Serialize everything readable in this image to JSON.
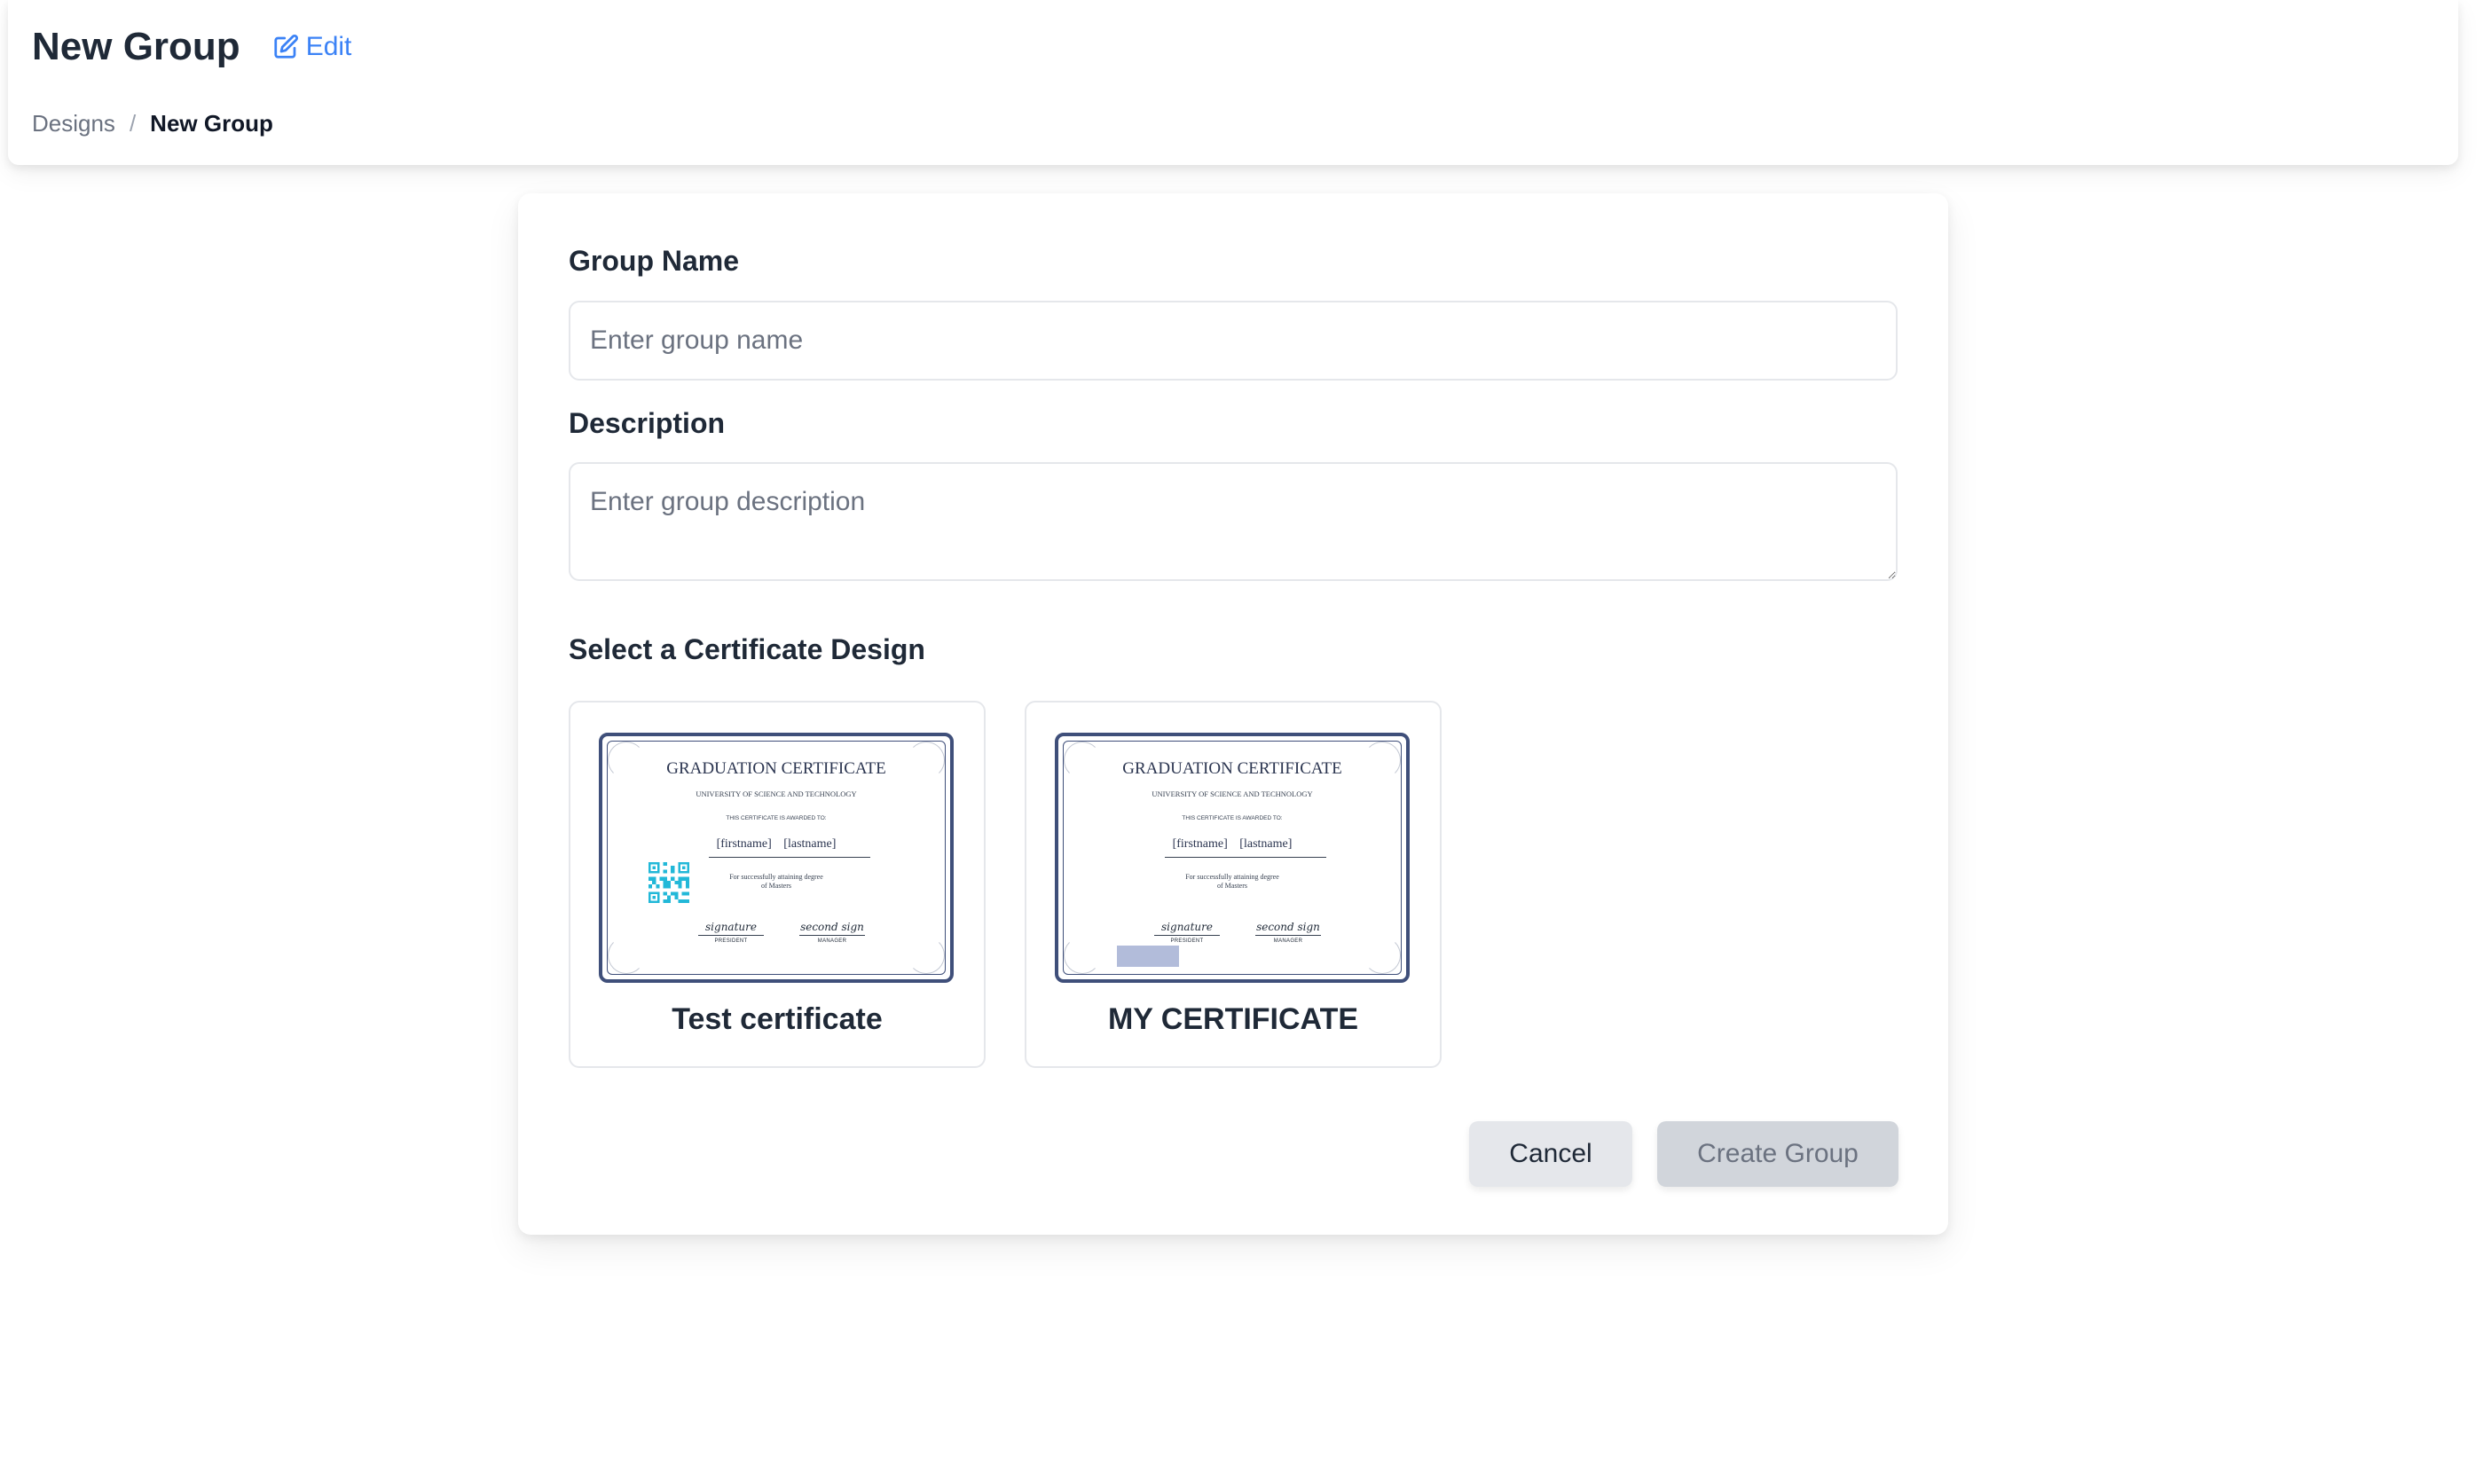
{
  "header": {
    "title": "New Group",
    "edit_label": "Edit",
    "breadcrumb": {
      "parent": "Designs",
      "separator": "/",
      "current": "New Group"
    }
  },
  "form": {
    "group_name": {
      "label": "Group Name",
      "placeholder": "Enter group name",
      "value": ""
    },
    "description": {
      "label": "Description",
      "placeholder": "Enter group description",
      "value": ""
    },
    "design_section_label": "Select a Certificate Design",
    "designs": [
      {
        "name": "Test certificate",
        "preview": {
          "title": "GRADUATION CERTIFICATE",
          "university": "UNIVERSITY OF SCIENCE AND TECHNOLOGY",
          "awarded": "THIS CERTIFICATE IS AWARDED TO:",
          "firstname": "[firstname]",
          "lastname": "[lastname]",
          "for_line1": "For successfully attaining degree",
          "for_line2": "of Masters",
          "sig1": "signature",
          "sig1_role": "PRESIDENT",
          "sig2": "second sign",
          "sig2_role": "MANAGER"
        }
      },
      {
        "name": "MY CERTIFICATE",
        "preview": {
          "title": "GRADUATION CERTIFICATE",
          "university": "UNIVERSITY OF SCIENCE AND TECHNOLOGY",
          "awarded": "THIS CERTIFICATE IS AWARDED TO:",
          "firstname": "[firstname]",
          "lastname": "[lastname]",
          "for_line1": "For successfully attaining degree",
          "for_line2": "of Masters",
          "sig1": "signature",
          "sig1_role": "PRESIDENT",
          "sig2": "second sign",
          "sig2_role": "MANAGER"
        }
      }
    ],
    "cancel_label": "Cancel",
    "create_label": "Create Group"
  },
  "colors": {
    "accent": "#3b82f6",
    "certificate_border": "#3f4f7a",
    "qr": "#22b8d8"
  }
}
